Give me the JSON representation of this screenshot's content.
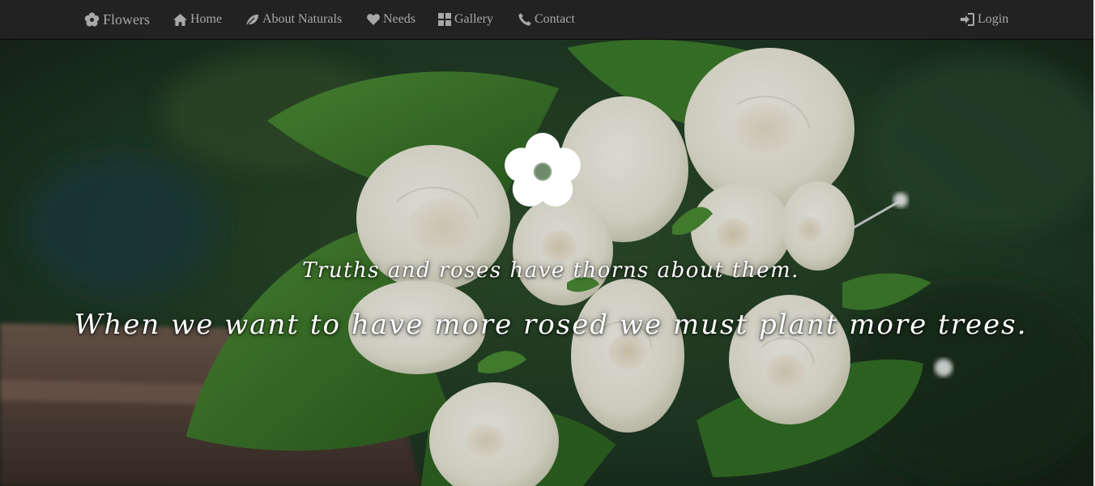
{
  "navbar": {
    "brand": {
      "label": "Flowers",
      "icon": "flower-icon"
    },
    "items": [
      {
        "label": "Home",
        "icon": "home-icon"
      },
      {
        "label": "About Naturals",
        "icon": "leaf-icon"
      },
      {
        "label": "Needs",
        "icon": "heart-icon"
      },
      {
        "label": "Gallery",
        "icon": "grid-icon"
      },
      {
        "label": "Contact",
        "icon": "phone-icon"
      }
    ],
    "login": {
      "label": "Login",
      "icon": "login-icon"
    }
  },
  "hero": {
    "icon": "flower-icon",
    "quote_primary": "Truths and roses have thorns about them.",
    "quote_secondary": "When we want to have more rosed we must plant more trees."
  },
  "colors": {
    "navbar_bg": "#222222",
    "nav_text": "#a8a8a8",
    "hero_text": "#ffffff",
    "leaf_green": "#3d7a2a",
    "rose_white": "#f2f1e6"
  }
}
